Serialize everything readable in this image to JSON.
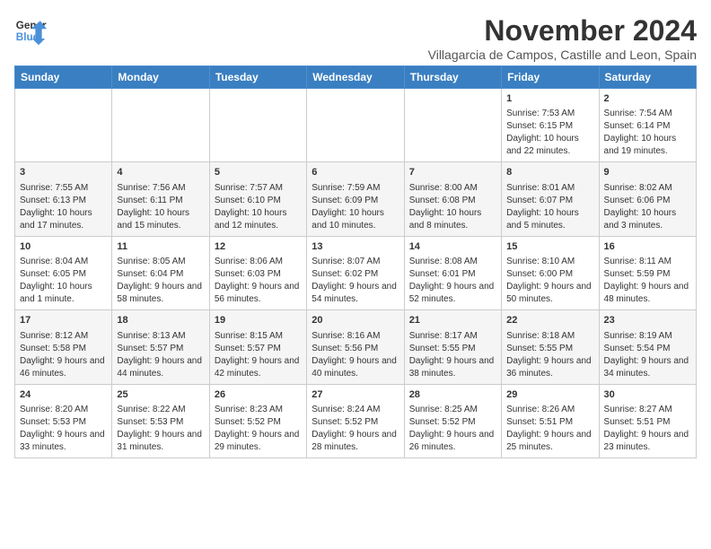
{
  "header": {
    "logo_line1": "General",
    "logo_line2": "Blue",
    "title": "November 2024",
    "location": "Villagarcia de Campos, Castille and Leon, Spain"
  },
  "weekdays": [
    "Sunday",
    "Monday",
    "Tuesday",
    "Wednesday",
    "Thursday",
    "Friday",
    "Saturday"
  ],
  "weeks": [
    [
      {
        "day": "",
        "content": ""
      },
      {
        "day": "",
        "content": ""
      },
      {
        "day": "",
        "content": ""
      },
      {
        "day": "",
        "content": ""
      },
      {
        "day": "",
        "content": ""
      },
      {
        "day": "1",
        "content": "Sunrise: 7:53 AM\nSunset: 6:15 PM\nDaylight: 10 hours and 22 minutes."
      },
      {
        "day": "2",
        "content": "Sunrise: 7:54 AM\nSunset: 6:14 PM\nDaylight: 10 hours and 19 minutes."
      }
    ],
    [
      {
        "day": "3",
        "content": "Sunrise: 7:55 AM\nSunset: 6:13 PM\nDaylight: 10 hours and 17 minutes."
      },
      {
        "day": "4",
        "content": "Sunrise: 7:56 AM\nSunset: 6:11 PM\nDaylight: 10 hours and 15 minutes."
      },
      {
        "day": "5",
        "content": "Sunrise: 7:57 AM\nSunset: 6:10 PM\nDaylight: 10 hours and 12 minutes."
      },
      {
        "day": "6",
        "content": "Sunrise: 7:59 AM\nSunset: 6:09 PM\nDaylight: 10 hours and 10 minutes."
      },
      {
        "day": "7",
        "content": "Sunrise: 8:00 AM\nSunset: 6:08 PM\nDaylight: 10 hours and 8 minutes."
      },
      {
        "day": "8",
        "content": "Sunrise: 8:01 AM\nSunset: 6:07 PM\nDaylight: 10 hours and 5 minutes."
      },
      {
        "day": "9",
        "content": "Sunrise: 8:02 AM\nSunset: 6:06 PM\nDaylight: 10 hours and 3 minutes."
      }
    ],
    [
      {
        "day": "10",
        "content": "Sunrise: 8:04 AM\nSunset: 6:05 PM\nDaylight: 10 hours and 1 minute."
      },
      {
        "day": "11",
        "content": "Sunrise: 8:05 AM\nSunset: 6:04 PM\nDaylight: 9 hours and 58 minutes."
      },
      {
        "day": "12",
        "content": "Sunrise: 8:06 AM\nSunset: 6:03 PM\nDaylight: 9 hours and 56 minutes."
      },
      {
        "day": "13",
        "content": "Sunrise: 8:07 AM\nSunset: 6:02 PM\nDaylight: 9 hours and 54 minutes."
      },
      {
        "day": "14",
        "content": "Sunrise: 8:08 AM\nSunset: 6:01 PM\nDaylight: 9 hours and 52 minutes."
      },
      {
        "day": "15",
        "content": "Sunrise: 8:10 AM\nSunset: 6:00 PM\nDaylight: 9 hours and 50 minutes."
      },
      {
        "day": "16",
        "content": "Sunrise: 8:11 AM\nSunset: 5:59 PM\nDaylight: 9 hours and 48 minutes."
      }
    ],
    [
      {
        "day": "17",
        "content": "Sunrise: 8:12 AM\nSunset: 5:58 PM\nDaylight: 9 hours and 46 minutes."
      },
      {
        "day": "18",
        "content": "Sunrise: 8:13 AM\nSunset: 5:57 PM\nDaylight: 9 hours and 44 minutes."
      },
      {
        "day": "19",
        "content": "Sunrise: 8:15 AM\nSunset: 5:57 PM\nDaylight: 9 hours and 42 minutes."
      },
      {
        "day": "20",
        "content": "Sunrise: 8:16 AM\nSunset: 5:56 PM\nDaylight: 9 hours and 40 minutes."
      },
      {
        "day": "21",
        "content": "Sunrise: 8:17 AM\nSunset: 5:55 PM\nDaylight: 9 hours and 38 minutes."
      },
      {
        "day": "22",
        "content": "Sunrise: 8:18 AM\nSunset: 5:55 PM\nDaylight: 9 hours and 36 minutes."
      },
      {
        "day": "23",
        "content": "Sunrise: 8:19 AM\nSunset: 5:54 PM\nDaylight: 9 hours and 34 minutes."
      }
    ],
    [
      {
        "day": "24",
        "content": "Sunrise: 8:20 AM\nSunset: 5:53 PM\nDaylight: 9 hours and 33 minutes."
      },
      {
        "day": "25",
        "content": "Sunrise: 8:22 AM\nSunset: 5:53 PM\nDaylight: 9 hours and 31 minutes."
      },
      {
        "day": "26",
        "content": "Sunrise: 8:23 AM\nSunset: 5:52 PM\nDaylight: 9 hours and 29 minutes."
      },
      {
        "day": "27",
        "content": "Sunrise: 8:24 AM\nSunset: 5:52 PM\nDaylight: 9 hours and 28 minutes."
      },
      {
        "day": "28",
        "content": "Sunrise: 8:25 AM\nSunset: 5:52 PM\nDaylight: 9 hours and 26 minutes."
      },
      {
        "day": "29",
        "content": "Sunrise: 8:26 AM\nSunset: 5:51 PM\nDaylight: 9 hours and 25 minutes."
      },
      {
        "day": "30",
        "content": "Sunrise: 8:27 AM\nSunset: 5:51 PM\nDaylight: 9 hours and 23 minutes."
      }
    ]
  ]
}
